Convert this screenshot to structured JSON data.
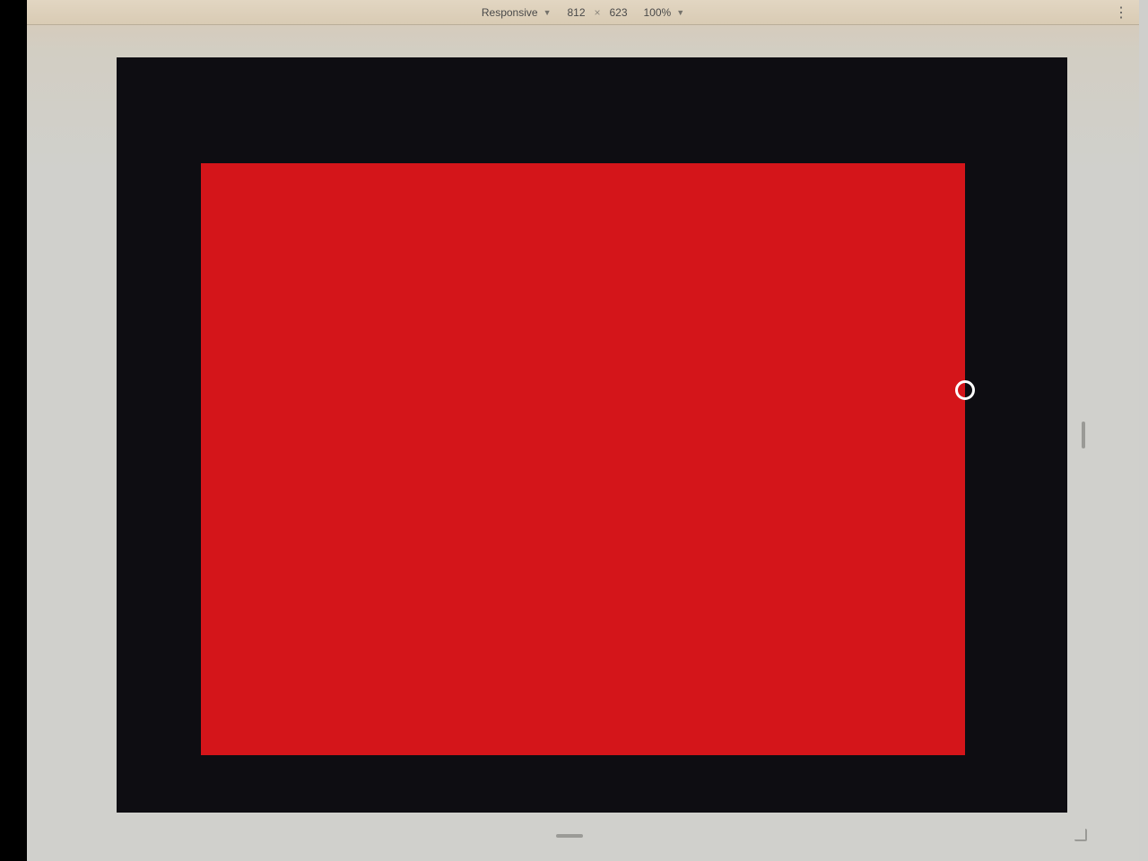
{
  "toolbar": {
    "device_label": "Responsive",
    "width": "812",
    "height": "623",
    "times": "×",
    "zoom": "100%"
  },
  "colors": {
    "frame": "#0e0d12",
    "page": "#d4151a"
  }
}
